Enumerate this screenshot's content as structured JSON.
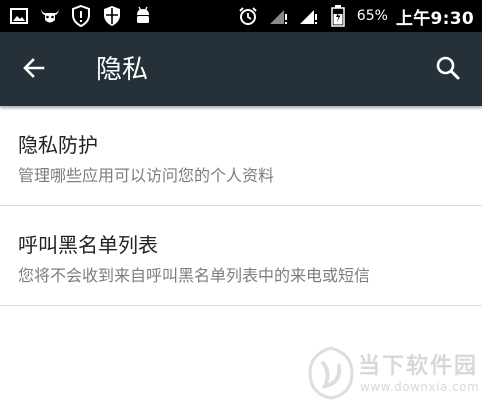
{
  "status_bar": {
    "battery_percent": "65%",
    "time": "上午9:30",
    "left_icons": [
      "image-icon",
      "bull-icon",
      "shield-alert-icon",
      "shield-icon",
      "android-icon"
    ],
    "right_icons": [
      "alarm-icon",
      "signal-icon",
      "signal-icon",
      "battery-icon"
    ]
  },
  "toolbar": {
    "title": "隐私",
    "background": "#253038"
  },
  "settings": [
    {
      "title": "隐私防护",
      "subtitle": "管理哪些应用可以访问您的个人资料"
    },
    {
      "title": "呼叫黑名单列表",
      "subtitle": "您将不会收到来自呼叫黑名单列表中的来电或短信"
    }
  ],
  "watermark": {
    "text": "当下软件园",
    "url": "www.downxia.com"
  }
}
